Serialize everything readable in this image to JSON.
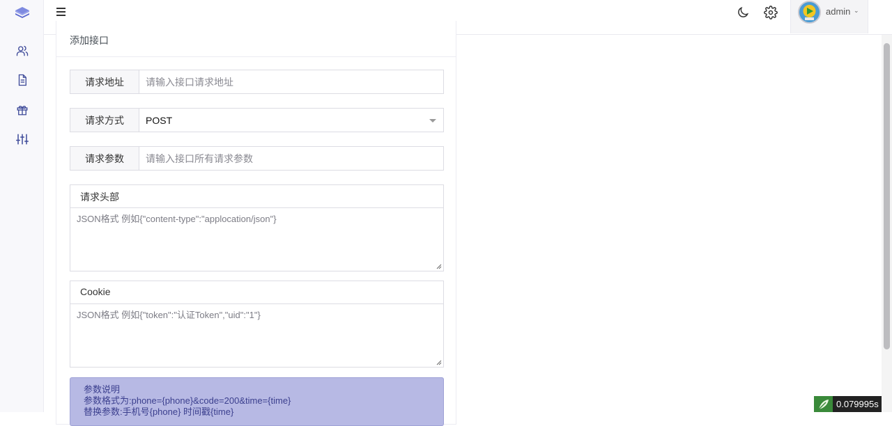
{
  "header": {
    "username": "admin",
    "caret": "⌄"
  },
  "sidebar": {
    "items": [
      "users-icon",
      "document-icon",
      "gift-icon",
      "sliders-icon"
    ]
  },
  "form": {
    "title": "添加接口",
    "url_label": "请求地址",
    "url_placeholder": "请输入接口请求地址",
    "method_label": "请求方式",
    "method_value": "POST",
    "params_label": "请求参数",
    "params_placeholder": "请输入接口所有请求参数",
    "headers_label": "请求头部",
    "headers_placeholder": "JSON格式 例如{\"content-type\":\"applocation/json\"}",
    "cookie_label": "Cookie",
    "cookie_placeholder": "JSON格式 例如{\"token\":\"认证Token\",\"uid\":\"1\"}"
  },
  "help": {
    "title": "参数说明",
    "line1": "参数格式为:phone={phone}&code=200&time={time}",
    "line2": "替换参数:手机号{phone} 时间戳{time}"
  },
  "timing": {
    "value": "0.079995s"
  },
  "colors": {
    "accent": "#3b5bb5",
    "alert_bg": "#b7b9e4",
    "alert_text": "#3b3f8e"
  }
}
